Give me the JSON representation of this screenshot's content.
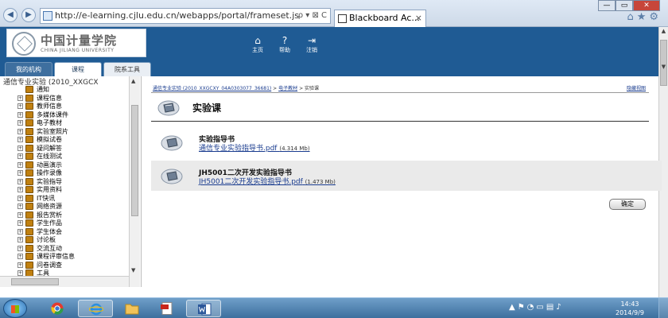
{
  "browser": {
    "address": "http://e-learning.cjlu.edu.cn/webapps/portal/frameset.js",
    "address_tools": "ρ ▾ ⊠ C",
    "tab_title": "Blackboard Ac...",
    "tab_close": "×"
  },
  "header": {
    "logo_text": "中国计量学院",
    "logo_sub": "CHINA JILIANG UNIVERSITY",
    "links": [
      {
        "label": "主页"
      },
      {
        "label": "帮助"
      },
      {
        "label": "注销"
      }
    ],
    "tabs": [
      {
        "label": "我的机构"
      },
      {
        "label": "课程"
      },
      {
        "label": "院系工具"
      }
    ]
  },
  "tree": {
    "title": "通信专业实验 (2010_XXGCX",
    "items": [
      {
        "label": "通知",
        "expander": ""
      },
      {
        "label": "课程信息",
        "expander": "+"
      },
      {
        "label": "教师信息",
        "expander": "+"
      },
      {
        "label": "多媒体课件",
        "expander": "+"
      },
      {
        "label": "电子教材",
        "expander": "+"
      },
      {
        "label": "实验室照片",
        "expander": "+"
      },
      {
        "label": "模拟试卷",
        "expander": "+"
      },
      {
        "label": "疑问解答",
        "expander": "+"
      },
      {
        "label": "在线测试",
        "expander": "+"
      },
      {
        "label": "动画演示",
        "expander": "+"
      },
      {
        "label": "操作录像",
        "expander": "+"
      },
      {
        "label": "实验指导",
        "expander": "+"
      },
      {
        "label": "实用资料",
        "expander": "+"
      },
      {
        "label": "IT快讯",
        "expander": "+"
      },
      {
        "label": "网络资源",
        "expander": "+"
      },
      {
        "label": "报告赏析",
        "expander": "+"
      },
      {
        "label": "学生作品",
        "expander": "+"
      },
      {
        "label": "学生体会",
        "expander": "+"
      },
      {
        "label": "讨论板",
        "expander": "+"
      },
      {
        "label": "交流互动",
        "expander": "+"
      },
      {
        "label": "课程评审信息",
        "expander": "+"
      },
      {
        "label": "问卷调查",
        "expander": "+"
      },
      {
        "label": "工具",
        "expander": "+"
      }
    ]
  },
  "main": {
    "breadcrumb": {
      "course": "通信专业实验 (2010_XXGCXY_04A0303077_36681)",
      "sep1": ">",
      "section": "电子教材",
      "sep2": ">",
      "current": "实验课"
    },
    "breadcrumb_right": "隐藏视图",
    "title": "实验课",
    "items": [
      {
        "title": "实验指导书",
        "file": "通信专业实验指导书.pdf",
        "size": "(4.314 Mb)"
      },
      {
        "title": "JH5001二次开发实验指导书",
        "file": "JH5001二次开发实验指导书.pdf",
        "size": "(1.473 Mb)"
      }
    ],
    "ok_label": "确定"
  },
  "taskbar": {
    "time": "14:43",
    "date": "2014/9/9"
  },
  "colors": {
    "header_blue": "#1f5b94",
    "link_blue": "#1a3c8f",
    "taskbar": "#3d6f9e"
  }
}
